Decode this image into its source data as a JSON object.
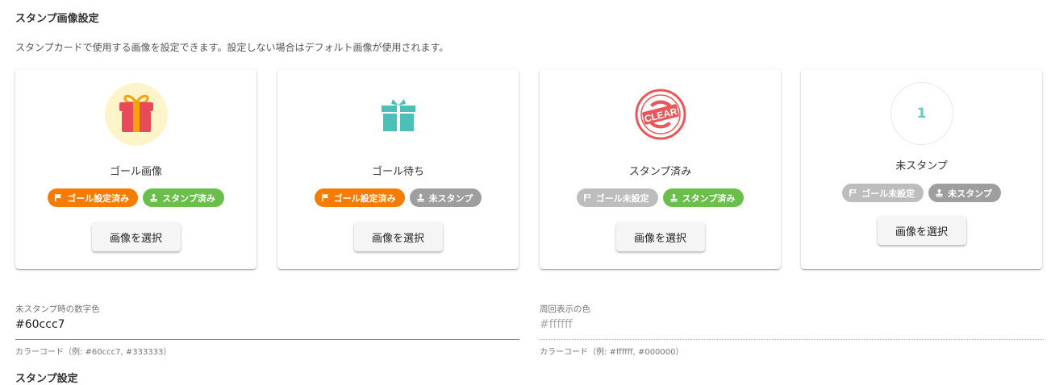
{
  "section": {
    "title": "スタンプ画像設定",
    "description": "スタンプカードで使用する画像を設定できます。設定しない場合はデフォルト画像が使用されます。"
  },
  "cards": [
    {
      "label": "ゴール画像",
      "chips": [
        "ゴール設定済み",
        "スタンプ済み"
      ],
      "button": "画像を選択"
    },
    {
      "label": "ゴール待ち",
      "chips": [
        "ゴール設定済み",
        "未スタンプ"
      ],
      "button": "画像を選択"
    },
    {
      "label": "スタンプ済み",
      "chips": [
        "ゴール未設定",
        "スタンプ済み"
      ],
      "button": "画像を選択",
      "stamp_text": "CLEAR"
    },
    {
      "label": "未スタンプ",
      "chips": [
        "ゴール未設定",
        "未スタンプ"
      ],
      "button": "画像を選択",
      "number": "1"
    }
  ],
  "fields": {
    "number_color": {
      "label": "未スタンプ時の数字色",
      "value": "#60ccc7",
      "hint": "カラーコード（例: #60ccc7, #333333）"
    },
    "cycle_color": {
      "label": "周回表示の色",
      "value": "#ffffff",
      "hint": "カラーコード（例: #ffffff, #000000）"
    }
  },
  "next_section_title": "スタンプ設定",
  "colors": {
    "accent_teal": "#4dbfb9",
    "chip_orange": "#f57c00",
    "chip_green": "#6abf4b",
    "stamp_red": "#e8575a"
  }
}
